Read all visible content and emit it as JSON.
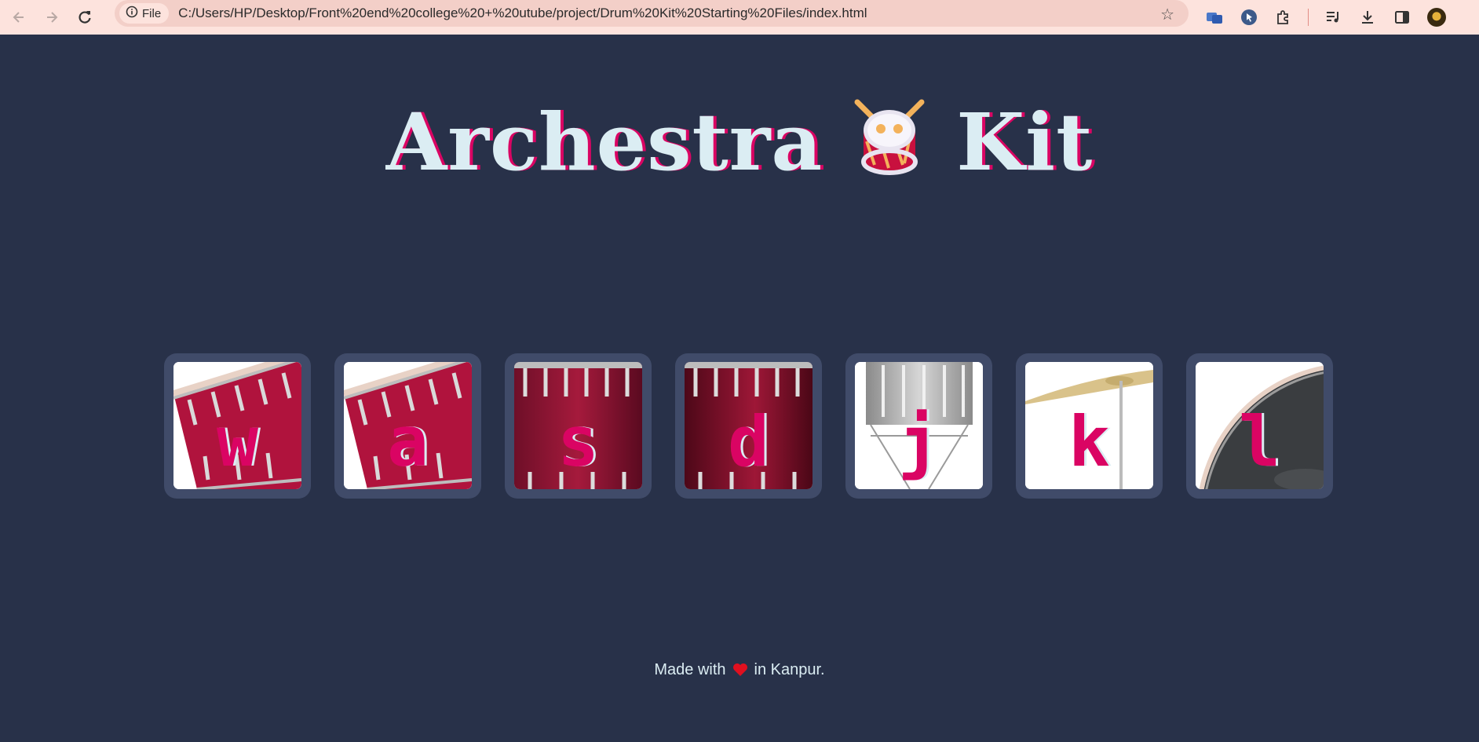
{
  "browser": {
    "site_chip_label": "File",
    "url": "C:/Users/HP/Desktop/Front%20end%20college%20+%20utube/project/Drum%20Kit%20Starting%20Files/index.html"
  },
  "page": {
    "title_left": "Archestra",
    "title_right": "Kit",
    "title_icon": "drum-emoji",
    "footer_before": "Made with",
    "footer_icon": "heart-emoji",
    "footer_after": "in Kanpur."
  },
  "drums": [
    {
      "key": "w",
      "image": "tom"
    },
    {
      "key": "a",
      "image": "tom"
    },
    {
      "key": "s",
      "image": "crash"
    },
    {
      "key": "d",
      "image": "kick"
    },
    {
      "key": "j",
      "image": "snare"
    },
    {
      "key": "k",
      "image": "cymbal"
    },
    {
      "key": "l",
      "image": "bass"
    }
  ],
  "colors": {
    "background": "#283149",
    "tile": "#404b69",
    "accent": "#da0463",
    "light": "#dbedf3",
    "chrome": "#fde3dd"
  }
}
